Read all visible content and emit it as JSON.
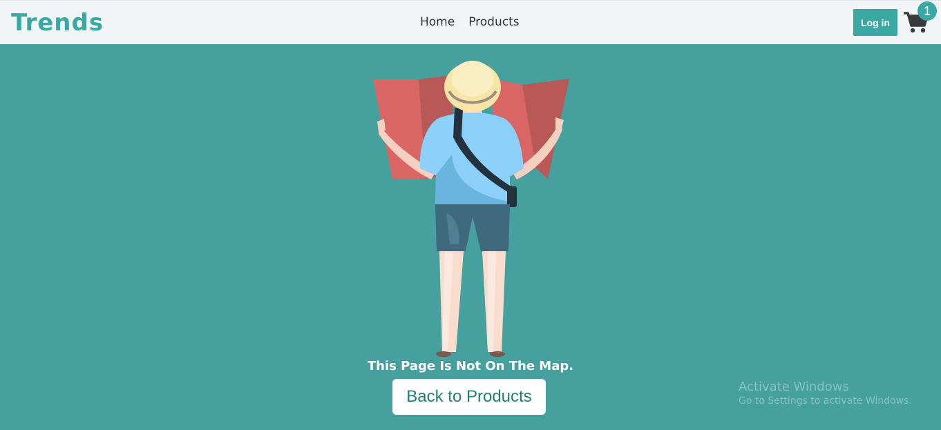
{
  "navbar": {
    "brand": "Trends",
    "links": [
      {
        "label": "Home"
      },
      {
        "label": "Products"
      }
    ],
    "login_label": "Log in",
    "cart_count": "1",
    "cart_icon": "shopping-cart-icon"
  },
  "main": {
    "message": "This Page Is Not On The Map.",
    "back_button_label": "Back to Products",
    "illustration": "traveler-with-map"
  },
  "watermark": {
    "title": "Activate Windows",
    "subtitle": "Go to Settings to activate Windows."
  },
  "colors": {
    "accent": "#3aa9a3",
    "background": "#46a09e",
    "navbar": "#f1f5f8"
  }
}
